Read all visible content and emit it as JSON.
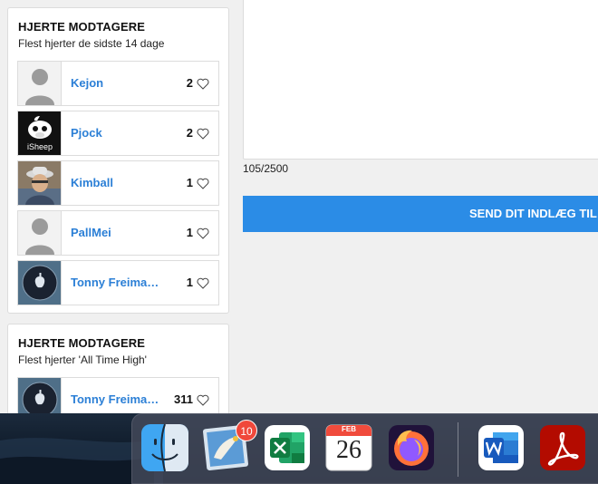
{
  "hearts_recent": {
    "title": "HJERTE MODTAGERE",
    "subtitle": "Flest hjerter de sidste 14 dage",
    "rows": [
      {
        "name": "Kejon",
        "count": "2"
      },
      {
        "name": "Pjock",
        "count": "2",
        "avatar_text": "iSheep"
      },
      {
        "name": "Kimball",
        "count": "1"
      },
      {
        "name": "PallMei",
        "count": "1"
      },
      {
        "name": "Tonny Freimann",
        "count": "1"
      }
    ]
  },
  "hearts_alltime": {
    "title": "HJERTE MODTAGERE",
    "subtitle": "Flest hjerter 'All Time High'",
    "rows": [
      {
        "name": "Tonny Freimann",
        "count": "311"
      }
    ]
  },
  "composer": {
    "counter": "105/2500",
    "send_label": "SEND DIT INDLÆG TIL"
  },
  "dock": {
    "mail_badge": "10",
    "calendar_month": "FEB",
    "calendar_day": "26",
    "apps": [
      "finder-icon",
      "mail-icon",
      "excel-icon",
      "calendar-icon",
      "firefox-icon",
      "word-icon",
      "acrobat-icon"
    ]
  },
  "colors": {
    "link": "#2b7fd6",
    "button": "#2b8ce6",
    "badge": "#f0483b"
  }
}
